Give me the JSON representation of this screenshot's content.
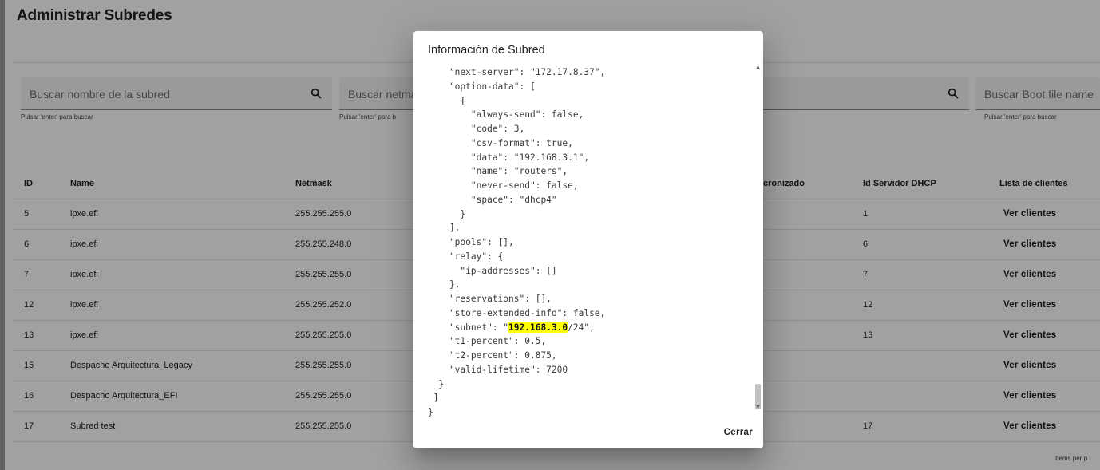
{
  "page": {
    "title": "Administrar Subredes",
    "searches": [
      {
        "placeholder": "Buscar nombre de la subred",
        "hint": "Pulsar 'enter' para buscar"
      },
      {
        "placeholder": "Buscar netmas",
        "hint": "Pulsar 'enter' para b"
      },
      {
        "placeholder": "",
        "hint": ""
      },
      {
        "placeholder": "Buscar Boot file name",
        "hint": "Pulsar 'enter' para buscar"
      }
    ],
    "table": {
      "headers": {
        "id": "ID",
        "name": "Name",
        "netmask": "Netmask",
        "sync": "cronizado",
        "dhcp": "Id Servidor DHCP",
        "clients": "Lista de clientes"
      },
      "rows": [
        {
          "id": "5",
          "name": "ipxe.efi",
          "netmask": "255.255.255.0",
          "dhcp": "1",
          "action": "Ver clientes"
        },
        {
          "id": "6",
          "name": "ipxe.efi",
          "netmask": "255.255.248.0",
          "dhcp": "6",
          "action": "Ver clientes"
        },
        {
          "id": "7",
          "name": "ipxe.efi",
          "netmask": "255.255.255.0",
          "dhcp": "7",
          "action": "Ver clientes"
        },
        {
          "id": "12",
          "name": "ipxe.efi",
          "netmask": "255.255.252.0",
          "dhcp": "12",
          "action": "Ver clientes"
        },
        {
          "id": "13",
          "name": "ipxe.efi",
          "netmask": "255.255.255.0",
          "dhcp": "13",
          "action": "Ver clientes"
        },
        {
          "id": "15",
          "name": "Despacho Arquitectura_Legacy",
          "netmask": "255.255.255.0",
          "dhcp": "",
          "action": "Ver clientes"
        },
        {
          "id": "16",
          "name": "Despacho Arquitectura_EFI",
          "netmask": "255.255.255.0",
          "dhcp": "",
          "action": "Ver clientes"
        },
        {
          "id": "17",
          "name": "Subred test",
          "netmask": "255.255.255.0",
          "dhcp": "17",
          "action": "Ver clientes"
        }
      ]
    },
    "paginator_label": "Items per p"
  },
  "dialog": {
    "title": "Información de Subred",
    "code_before": "    \"next-server\": \"172.17.8.37\",\n    \"option-data\": [\n      {\n        \"always-send\": false,\n        \"code\": 3,\n        \"csv-format\": true,\n        \"data\": \"192.168.3.1\",\n        \"name\": \"routers\",\n        \"never-send\": false,\n        \"space\": \"dhcp4\"\n      }\n    ],\n    \"pools\": [],\n    \"relay\": {\n      \"ip-addresses\": []\n    },\n    \"reservations\": [],\n    \"store-extended-info\": false,\n    \"subnet\": \"",
    "code_highlight": "192.168.3.0",
    "code_after": "/24\",\n    \"t1-percent\": 0.5,\n    \"t2-percent\": 0.875,\n    \"valid-lifetime\": 7200\n  }\n ]\n}",
    "close_label": "Cerrar",
    "scroll_up_icon": "triangle-up",
    "scroll_down_icon": "triangle-down"
  }
}
